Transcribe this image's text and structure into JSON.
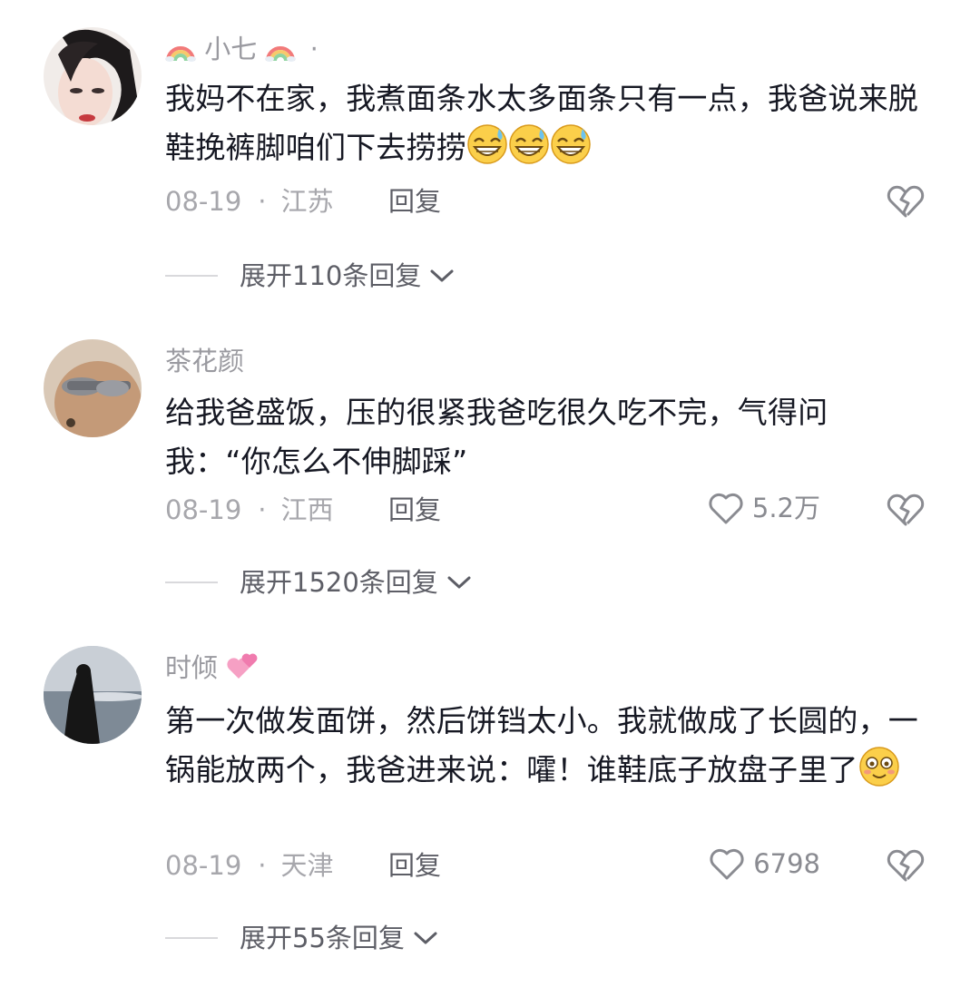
{
  "comments": [
    {
      "username": "小七",
      "username_decor_icon": "rainbow-icon",
      "username_suffix": "·",
      "text": "我妈不在家，我煮面条水太多面条只有一点，我爸说来脱鞋挽裤脚咱们下去捞捞",
      "emojis": [
        "grinning-sweat-emoji",
        "grinning-sweat-emoji",
        "grinning-sweat-emoji"
      ],
      "date": "08-19",
      "location": "江苏",
      "reply_label": "回复",
      "like_count": "",
      "expand_label": "展开110条回复"
    },
    {
      "username": "茶花颜",
      "text": "给我爸盛饭，压的很紧我爸吃很久吃不完，气得问我：“你怎么不伸脚踩”",
      "date": "08-19",
      "location": "江西",
      "reply_label": "回复",
      "like_count": "5.2万",
      "expand_label": "展开1520条回复"
    },
    {
      "username": "时倾",
      "username_decor_icon": "two-hearts-icon",
      "text": "第一次做发面饼，然后饼铛太小。我就做成了长圆的，一锅能放两个，我爸进来说：嚯！谁鞋底子放盘子里了",
      "emojis": [
        "flushed-smile-emoji"
      ],
      "date": "08-19",
      "location": "天津",
      "reply_label": "回复",
      "like_count": "6798",
      "expand_label": "展开55条回复"
    }
  ],
  "colors": {
    "text_primary": "#161823",
    "text_secondary": "#9a9aa0",
    "reply": "#5d5e66",
    "icon": "#8a8b91"
  }
}
